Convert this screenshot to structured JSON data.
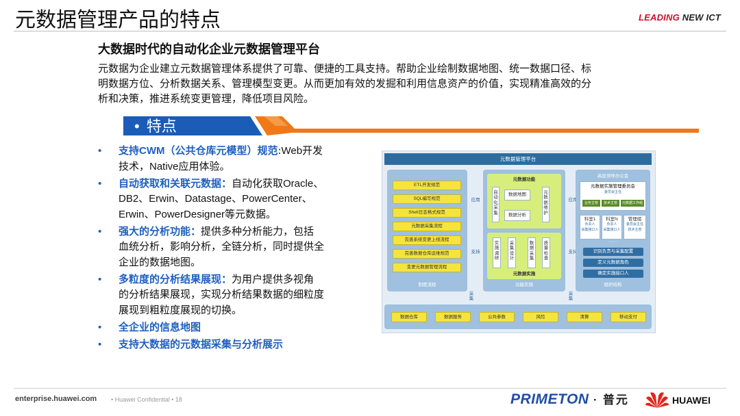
{
  "header": {
    "title": "元数据管理产品的特点",
    "brand_leading": "LEADING",
    "brand_rest": "NEW ICT"
  },
  "subtitle": "大数据时代的自动化企业元数据管理平台",
  "intro": "元数据为企业建立元数据管理体系提供了可靠、便捷的工具支持。帮助企业绘制数据地图、统一数据口径、标明数据方位、分析数据关系、管理模型变更。从而更加有效的发掘和利用信息资产的价值，实现精准高效的分析和决策，推进系统变更管理，降低项目风险。",
  "section": {
    "bullet": "•",
    "label": "特点"
  },
  "features": [
    {
      "bullet": "•",
      "heading": "支持CWM（公共仓库元模型）规范:",
      "text": "Web开发技术，Native应用体验。"
    },
    {
      "bullet": "•",
      "heading": "自动获取和关联元数据：",
      "text": "自动化获取Oracle、DB2、Erwin、Datastage、PowerCenter、Erwin、PowerDesigner等元数据。"
    },
    {
      "bullet": "•",
      "heading": "强大的分析功能：",
      "text": "提供多种分析能力，包括血统分析，影响分析，全链分析，同时提供全企业的数据地图。"
    },
    {
      "bullet": "•",
      "heading": "多粒度的分析结果展现：",
      "text": "为用户提供多视角的分析结果展现，实现分析结果数据的细粒度展现到粗粒度展现的切换。"
    },
    {
      "bullet": "•",
      "heading": "全企业的信息地图",
      "text": ""
    },
    {
      "bullet": "•",
      "heading": "支持大数据的元数据采集与分析展示",
      "text": ""
    }
  ],
  "diagram": {
    "top_title": "元数据管理平台",
    "left_panel": {
      "items": [
        "ETL开发规范",
        "SQL编写规范",
        "Shell日志格式规范",
        "元数据采集流程",
        "完善系统变更上线流程",
        "完善数据仓库运维规范",
        "变更元数据管理流程"
      ],
      "footer": "制度流程"
    },
    "mid_panel": {
      "func_title": "元数据功能",
      "func_left": "自动化采集",
      "func_items": [
        "数据地图",
        "数据分析"
      ],
      "func_right": "元数据维护",
      "impl_items": [
        "实施调研",
        "采集设计",
        "数据采集",
        "质量检查"
      ],
      "impl_title": "元数据实施",
      "footer": "功能实施"
    },
    "right_panel": {
      "leader": "高层领导办公会",
      "committee": "元数据实施管理委员会",
      "committee_sub": "委员会主任",
      "committee_roles": [
        "业务主管",
        "技术主管",
        "元数据工作组"
      ],
      "teams": [
        {
          "name": "科室1",
          "role1": "负责人",
          "role2": "采集接口人"
        },
        {
          "name": "科室N",
          "role1": "负责人",
          "role2": "采集接口人"
        },
        {
          "name": "管理组",
          "role1": "委员会主任",
          "role2": "技术主管"
        }
      ],
      "ellipsis": "……",
      "actions": [
        "识别负责与采集配置",
        "定义元数据角色",
        "确定实施接口人"
      ],
      "footer": "组织结构"
    },
    "arrows": {
      "apply1": "应用",
      "apply2": "应用",
      "support1": "支持",
      "support2": "支持",
      "collect1": "采集",
      "collect2": "采集"
    },
    "sources": [
      "数据仓库",
      "数据服务",
      "公共参数",
      "风险",
      "清算",
      "移动支付"
    ]
  },
  "footer": {
    "site": "enterprise.huawei.com",
    "sep1": "•",
    "confidential": "Huawei Confidential",
    "sep2": "•",
    "page": "18",
    "primeton": "PRIMETON",
    "dot": "·",
    "primeton_cn": "普元",
    "huawei": "HUAWEI"
  },
  "colors": {
    "accent_blue": "#1f5fbf",
    "banner_blue": "#1a5cb8",
    "banner_orange": "#f07818",
    "brand_red": "#c8102e"
  }
}
